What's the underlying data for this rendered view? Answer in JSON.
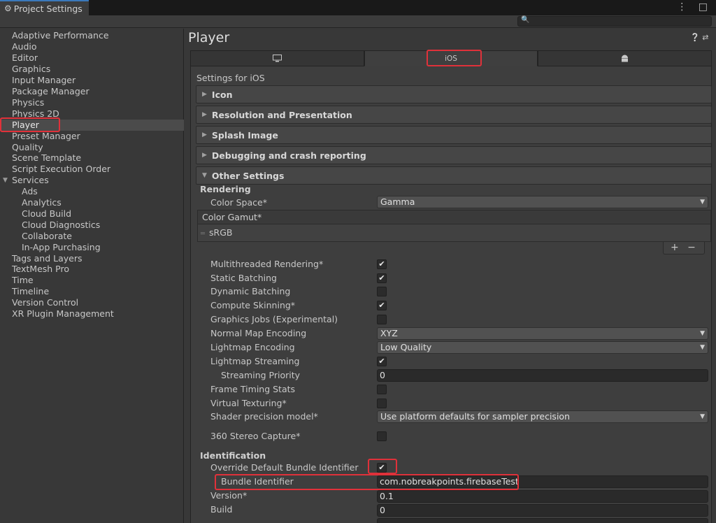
{
  "window": {
    "tab_title": "Project Settings"
  },
  "nav": {
    "items": [
      {
        "label": "Adaptive Performance",
        "indent": 0
      },
      {
        "label": "Audio",
        "indent": 0
      },
      {
        "label": "Editor",
        "indent": 0
      },
      {
        "label": "Graphics",
        "indent": 0
      },
      {
        "label": "Input Manager",
        "indent": 0
      },
      {
        "label": "Package Manager",
        "indent": 0
      },
      {
        "label": "Physics",
        "indent": 0
      },
      {
        "label": "Physics 2D",
        "indent": 0
      },
      {
        "label": "Player",
        "indent": 0,
        "selected": true
      },
      {
        "label": "Preset Manager",
        "indent": 0
      },
      {
        "label": "Quality",
        "indent": 0
      },
      {
        "label": "Scene Template",
        "indent": 0
      },
      {
        "label": "Script Execution Order",
        "indent": 0
      },
      {
        "label": "Services",
        "indent": 0,
        "expanded": true
      },
      {
        "label": "Ads",
        "indent": 1
      },
      {
        "label": "Analytics",
        "indent": 1
      },
      {
        "label": "Cloud Build",
        "indent": 1
      },
      {
        "label": "Cloud Diagnostics",
        "indent": 1
      },
      {
        "label": "Collaborate",
        "indent": 1
      },
      {
        "label": "In-App Purchasing",
        "indent": 1
      },
      {
        "label": "Tags and Layers",
        "indent": 0
      },
      {
        "label": "TextMesh Pro",
        "indent": 0
      },
      {
        "label": "Time",
        "indent": 0
      },
      {
        "label": "Timeline",
        "indent": 0
      },
      {
        "label": "Version Control",
        "indent": 0
      },
      {
        "label": "XR Plugin Management",
        "indent": 0
      }
    ]
  },
  "main": {
    "title": "Player",
    "platform_tabs": [
      {
        "icon": "monitor-icon",
        "label": ""
      },
      {
        "icon": "",
        "label": "iOS",
        "active": true
      },
      {
        "icon": "android-icon",
        "label": ""
      }
    ],
    "settings_for": "Settings for iOS",
    "foldouts": [
      "Icon",
      "Resolution and Presentation",
      "Splash Image",
      "Debugging and crash reporting",
      "Other Settings"
    ],
    "rendering": {
      "header": "Rendering",
      "color_space_label": "Color Space*",
      "color_space_value": "Gamma",
      "color_gamut_header": "Color Gamut*",
      "color_gamut_item": "sRGB",
      "list_buttons": "+ −"
    },
    "props": [
      {
        "label": "Multithreaded Rendering*",
        "type": "check",
        "checked": true
      },
      {
        "label": "Static Batching",
        "type": "check",
        "checked": true
      },
      {
        "label": "Dynamic Batching",
        "type": "check",
        "checked": false
      },
      {
        "label": "Compute Skinning*",
        "type": "check",
        "checked": true
      },
      {
        "label": "Graphics Jobs (Experimental)",
        "type": "check",
        "checked": false
      },
      {
        "label": "Normal Map Encoding",
        "type": "dropdown",
        "value": "XYZ"
      },
      {
        "label": "Lightmap Encoding",
        "type": "dropdown",
        "value": "Low Quality"
      },
      {
        "label": "Lightmap Streaming",
        "type": "check",
        "checked": true
      },
      {
        "label": "Streaming Priority",
        "type": "text",
        "value": "0",
        "indent": true
      },
      {
        "label": "Frame Timing Stats",
        "type": "check",
        "checked": false
      },
      {
        "label": "Virtual Texturing*",
        "type": "check",
        "checked": false
      },
      {
        "label": "Shader precision model*",
        "type": "dropdown",
        "value": "Use platform defaults for sampler precision"
      },
      {
        "label": "360 Stereo Capture*",
        "type": "check",
        "checked": false
      }
    ],
    "identification": {
      "header": "Identification",
      "override_label": "Override Default Bundle Identifier",
      "override_checked": true,
      "bundle_label": "Bundle Identifier",
      "bundle_value": "com.nobreakpoints.firebaseTest",
      "version_label": "Version*",
      "version_value": "0.1",
      "build_label": "Build",
      "build_value": "0"
    }
  },
  "colors": {
    "highlight": "#e0313a",
    "selection": "#4b4b4b"
  }
}
